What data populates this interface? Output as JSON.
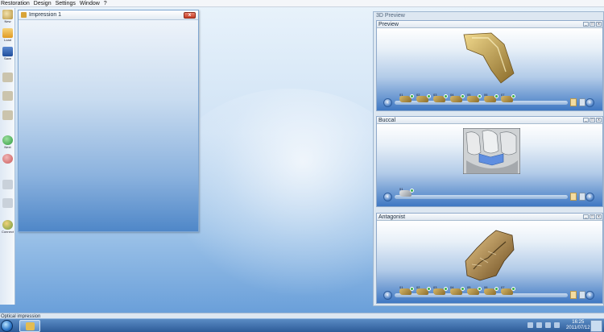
{
  "menubar": {
    "items": [
      "Restoration",
      "Design",
      "Settings",
      "Window",
      "?"
    ]
  },
  "toolbar": {
    "items": [
      {
        "label": "New",
        "icon": "tooth-icon",
        "color": "#d9bd73"
      },
      {
        "label": "Load",
        "icon": "folder-icon",
        "color": "#f0b537"
      },
      {
        "label": "Save",
        "icon": "floppy-disk-icon",
        "color": "#2d63b8"
      },
      {
        "label": "",
        "icon": "tooth-prep-icon",
        "color": "#c8c0a6"
      },
      {
        "label": "",
        "icon": "tooth-design-icon",
        "color": "#c8c0a6"
      },
      {
        "label": "",
        "icon": "tooth-mill-icon",
        "color": "#c8c0a6"
      },
      {
        "label": "Next",
        "icon": "next-arrow-icon",
        "color": "#35a947"
      },
      {
        "label": "",
        "icon": "back-arrow-icon",
        "color": "#d46d6d"
      },
      {
        "label": "",
        "icon": "grid-icon",
        "color": "#c5cdd6"
      },
      {
        "label": "",
        "icon": "grid-icon",
        "color": "#c5cdd6"
      },
      {
        "label": "Connect",
        "icon": "connect-icon",
        "color": "#7aa64a"
      }
    ]
  },
  "impression": {
    "title": "Impression 1",
    "close": "x"
  },
  "preview": {
    "title": "3D Preview",
    "panels": [
      {
        "title": "Preview",
        "thumbs": [
          "01",
          "02",
          "03",
          "04",
          "05",
          "06",
          "07"
        ]
      },
      {
        "title": "Buccal",
        "thumbs": [
          "01"
        ]
      },
      {
        "title": "Antagonist",
        "thumbs": [
          "01",
          "02",
          "03",
          "04",
          "05",
          "06",
          "07"
        ]
      }
    ],
    "panel_buttons": [
      "_",
      "□",
      "x"
    ],
    "nav_left": "‹",
    "nav_right": "›"
  },
  "status": {
    "text": "Optical impression"
  },
  "taskbar": {
    "time": "16:25",
    "date": "2011/07/12"
  },
  "colors": {
    "accent": "#2d63b8",
    "check": "#3bb04a",
    "close": "#c43b25"
  }
}
